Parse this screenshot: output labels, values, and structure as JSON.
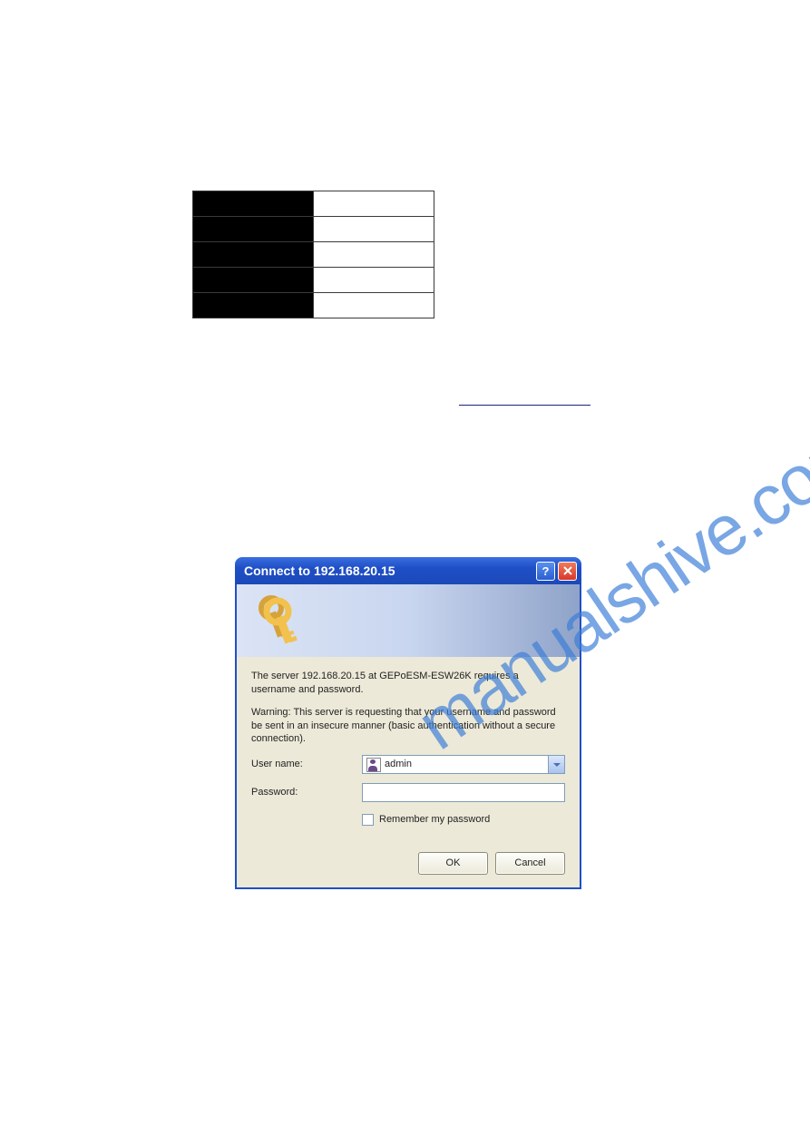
{
  "watermark": "manualshive.com",
  "dialog": {
    "title": "Connect to 192.168.20.15",
    "help_label": "?",
    "close_label": "×",
    "body_text1": "The server 192.168.20.15 at GEPoESM-ESW26K requires a username and password.",
    "body_text2": "Warning: This server is requesting that your username and password be sent in an insecure manner (basic authentication without a secure connection).",
    "username_label": "User name:",
    "username_value": "admin",
    "password_label": "Password:",
    "password_value": "",
    "remember_label": "Remember my password",
    "ok_label": "OK",
    "cancel_label": "Cancel"
  },
  "table": {
    "rows": [
      {
        "left": "",
        "right": ""
      },
      {
        "left": "",
        "right": ""
      },
      {
        "left": "",
        "right": ""
      },
      {
        "left": "",
        "right": ""
      },
      {
        "left": "",
        "right": ""
      }
    ]
  }
}
